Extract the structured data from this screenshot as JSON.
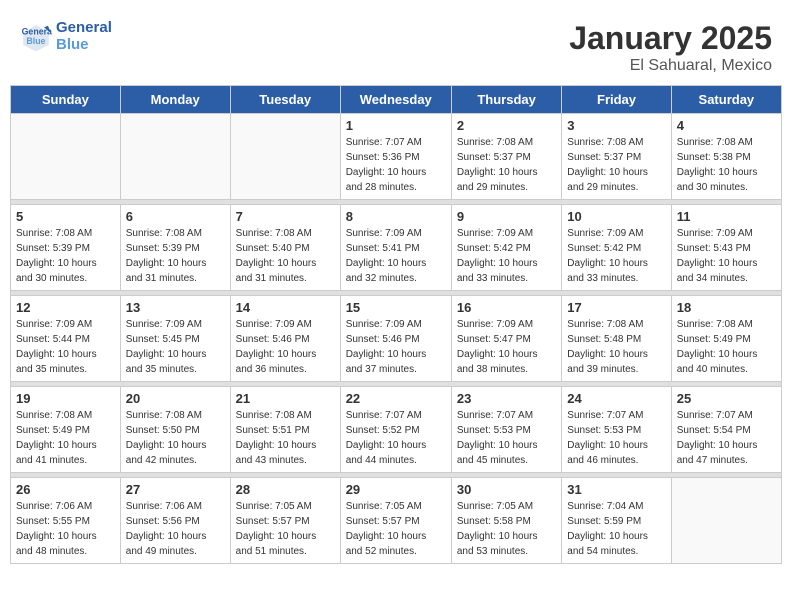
{
  "header": {
    "logo_general": "General",
    "logo_blue": "Blue",
    "month_year": "January 2025",
    "location": "El Sahuaral, Mexico"
  },
  "weekdays": [
    "Sunday",
    "Monday",
    "Tuesday",
    "Wednesday",
    "Thursday",
    "Friday",
    "Saturday"
  ],
  "weeks": [
    [
      {
        "day": "",
        "info": ""
      },
      {
        "day": "",
        "info": ""
      },
      {
        "day": "",
        "info": ""
      },
      {
        "day": "1",
        "info": "Sunrise: 7:07 AM\nSunset: 5:36 PM\nDaylight: 10 hours\nand 28 minutes."
      },
      {
        "day": "2",
        "info": "Sunrise: 7:08 AM\nSunset: 5:37 PM\nDaylight: 10 hours\nand 29 minutes."
      },
      {
        "day": "3",
        "info": "Sunrise: 7:08 AM\nSunset: 5:37 PM\nDaylight: 10 hours\nand 29 minutes."
      },
      {
        "day": "4",
        "info": "Sunrise: 7:08 AM\nSunset: 5:38 PM\nDaylight: 10 hours\nand 30 minutes."
      }
    ],
    [
      {
        "day": "5",
        "info": "Sunrise: 7:08 AM\nSunset: 5:39 PM\nDaylight: 10 hours\nand 30 minutes."
      },
      {
        "day": "6",
        "info": "Sunrise: 7:08 AM\nSunset: 5:39 PM\nDaylight: 10 hours\nand 31 minutes."
      },
      {
        "day": "7",
        "info": "Sunrise: 7:08 AM\nSunset: 5:40 PM\nDaylight: 10 hours\nand 31 minutes."
      },
      {
        "day": "8",
        "info": "Sunrise: 7:09 AM\nSunset: 5:41 PM\nDaylight: 10 hours\nand 32 minutes."
      },
      {
        "day": "9",
        "info": "Sunrise: 7:09 AM\nSunset: 5:42 PM\nDaylight: 10 hours\nand 33 minutes."
      },
      {
        "day": "10",
        "info": "Sunrise: 7:09 AM\nSunset: 5:42 PM\nDaylight: 10 hours\nand 33 minutes."
      },
      {
        "day": "11",
        "info": "Sunrise: 7:09 AM\nSunset: 5:43 PM\nDaylight: 10 hours\nand 34 minutes."
      }
    ],
    [
      {
        "day": "12",
        "info": "Sunrise: 7:09 AM\nSunset: 5:44 PM\nDaylight: 10 hours\nand 35 minutes."
      },
      {
        "day": "13",
        "info": "Sunrise: 7:09 AM\nSunset: 5:45 PM\nDaylight: 10 hours\nand 35 minutes."
      },
      {
        "day": "14",
        "info": "Sunrise: 7:09 AM\nSunset: 5:46 PM\nDaylight: 10 hours\nand 36 minutes."
      },
      {
        "day": "15",
        "info": "Sunrise: 7:09 AM\nSunset: 5:46 PM\nDaylight: 10 hours\nand 37 minutes."
      },
      {
        "day": "16",
        "info": "Sunrise: 7:09 AM\nSunset: 5:47 PM\nDaylight: 10 hours\nand 38 minutes."
      },
      {
        "day": "17",
        "info": "Sunrise: 7:08 AM\nSunset: 5:48 PM\nDaylight: 10 hours\nand 39 minutes."
      },
      {
        "day": "18",
        "info": "Sunrise: 7:08 AM\nSunset: 5:49 PM\nDaylight: 10 hours\nand 40 minutes."
      }
    ],
    [
      {
        "day": "19",
        "info": "Sunrise: 7:08 AM\nSunset: 5:49 PM\nDaylight: 10 hours\nand 41 minutes."
      },
      {
        "day": "20",
        "info": "Sunrise: 7:08 AM\nSunset: 5:50 PM\nDaylight: 10 hours\nand 42 minutes."
      },
      {
        "day": "21",
        "info": "Sunrise: 7:08 AM\nSunset: 5:51 PM\nDaylight: 10 hours\nand 43 minutes."
      },
      {
        "day": "22",
        "info": "Sunrise: 7:07 AM\nSunset: 5:52 PM\nDaylight: 10 hours\nand 44 minutes."
      },
      {
        "day": "23",
        "info": "Sunrise: 7:07 AM\nSunset: 5:53 PM\nDaylight: 10 hours\nand 45 minutes."
      },
      {
        "day": "24",
        "info": "Sunrise: 7:07 AM\nSunset: 5:53 PM\nDaylight: 10 hours\nand 46 minutes."
      },
      {
        "day": "25",
        "info": "Sunrise: 7:07 AM\nSunset: 5:54 PM\nDaylight: 10 hours\nand 47 minutes."
      }
    ],
    [
      {
        "day": "26",
        "info": "Sunrise: 7:06 AM\nSunset: 5:55 PM\nDaylight: 10 hours\nand 48 minutes."
      },
      {
        "day": "27",
        "info": "Sunrise: 7:06 AM\nSunset: 5:56 PM\nDaylight: 10 hours\nand 49 minutes."
      },
      {
        "day": "28",
        "info": "Sunrise: 7:05 AM\nSunset: 5:57 PM\nDaylight: 10 hours\nand 51 minutes."
      },
      {
        "day": "29",
        "info": "Sunrise: 7:05 AM\nSunset: 5:57 PM\nDaylight: 10 hours\nand 52 minutes."
      },
      {
        "day": "30",
        "info": "Sunrise: 7:05 AM\nSunset: 5:58 PM\nDaylight: 10 hours\nand 53 minutes."
      },
      {
        "day": "31",
        "info": "Sunrise: 7:04 AM\nSunset: 5:59 PM\nDaylight: 10 hours\nand 54 minutes."
      },
      {
        "day": "",
        "info": ""
      }
    ]
  ]
}
